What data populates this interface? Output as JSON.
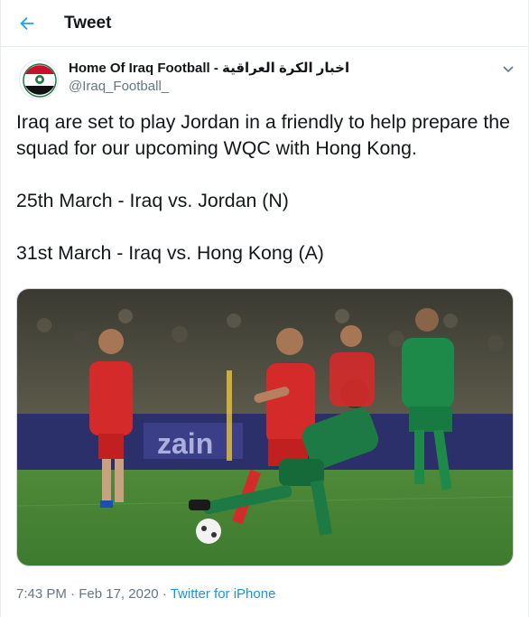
{
  "header": {
    "title": "Tweet"
  },
  "author": {
    "display_name": "Home Of Iraq Football - اخبار الكرة العراقية",
    "handle": "@Iraq_Football_"
  },
  "tweet": {
    "lines": [
      "Iraq are set to play Jordan in a friendly to help prepare the squad for  our upcoming WQC with Hong Kong.",
      "25th March - Iraq vs. Jordan (N)",
      "31st March - Iraq vs. Hong Kong (A)"
    ]
  },
  "media": {
    "banner_text": "zain"
  },
  "meta": {
    "time": "7:43 PM",
    "separator": "·",
    "date": "Feb 17, 2020",
    "source": "Twitter for iPhone"
  },
  "colors": {
    "accent": "#1da1f2",
    "link": "#1b95e0",
    "secondary_text": "#657786",
    "iraq_green": "#1e7a45",
    "hk_red": "#d42a2a"
  },
  "icons": {
    "back": "back-arrow-icon",
    "caret": "chevron-down-icon"
  }
}
